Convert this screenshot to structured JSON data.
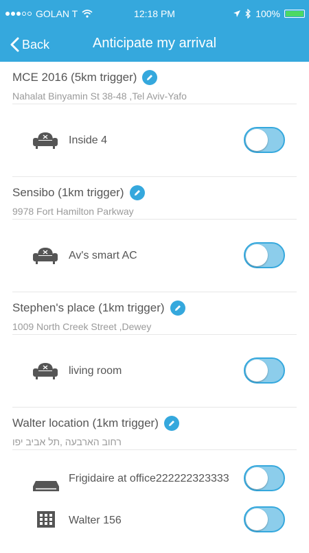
{
  "status_bar": {
    "carrier": "GOLAN T",
    "time": "12:18 PM",
    "battery": "100%",
    "battery_level": 1.0
  },
  "nav": {
    "back_label": "Back",
    "title": "Anticipate my arrival"
  },
  "locations": [
    {
      "name": "MCE 2016  (5km trigger)",
      "address": "Nahalat Binyamin St 38-48 ,Tel Aviv-Yafo",
      "devices": [
        {
          "name": "Inside 4",
          "icon": "armchair-icon",
          "enabled": false
        }
      ]
    },
    {
      "name": "Sensibo  (1km trigger)",
      "address": "9978 Fort Hamilton Parkway",
      "devices": [
        {
          "name": "Av's smart AC",
          "icon": "armchair-icon",
          "enabled": false
        }
      ]
    },
    {
      "name": "Stephen's place  (1km trigger)",
      "address": "1009 North Creek Street ,Dewey",
      "devices": [
        {
          "name": "living room",
          "icon": "armchair-icon",
          "enabled": false
        }
      ]
    },
    {
      "name": "Walter location  (1km trigger)",
      "address": "רחוב הארבעה ,תל אביב יפו",
      "devices": [
        {
          "name": "Frigidaire at office222222323333",
          "icon": "air-conditioner-icon",
          "enabled": false
        },
        {
          "name": "Walter 156",
          "icon": "grid-icon",
          "enabled": false
        }
      ]
    }
  ],
  "colors": {
    "accent": "#35a8dd",
    "toggle_off_bg": "#8ccdeb",
    "text": "#555555",
    "subtext": "#9a9a9a"
  }
}
